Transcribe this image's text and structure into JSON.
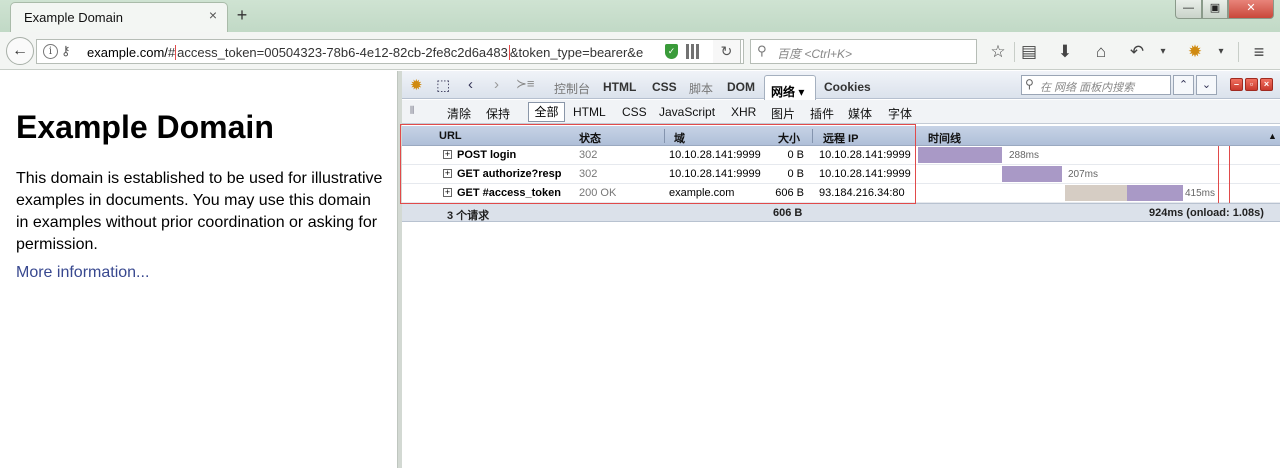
{
  "window": {
    "tab_title": "Example Domain",
    "tab_close": "×",
    "new_tab": "+",
    "min": "—",
    "max": "▣",
    "close": "✕"
  },
  "nav": {
    "back": "←",
    "url_host": "example.com/",
    "url_hash": "#",
    "url_token": "access_token=00504323-78b6-4e12-82cb-2fe8c2d6a483",
    "url_rest": "&token_type=bearer&e",
    "reload": "↻",
    "search_placeholder": "百度 <Ctrl+K>",
    "icons": [
      "star-icon",
      "reading-list-icon",
      "download-icon",
      "home-icon",
      "undo-icon",
      "firebug-icon",
      "menu-icon"
    ]
  },
  "page": {
    "title": "Example Domain",
    "body": "This domain is established to be used for illustrative examples in documents. You may use this domain in examples without prior coordination or asking for permission.",
    "link": "More information..."
  },
  "firebug": {
    "tabs": {
      "console": "控制台",
      "html": "HTML",
      "css": "CSS",
      "script": "脚本",
      "dom": "DOM",
      "net": "网络 ▾",
      "cookies": "Cookies"
    },
    "search_placeholder": "在 网络 面板内搜索",
    "filters": {
      "clear": "清除",
      "persist": "保持",
      "all": "全部",
      "html": "HTML",
      "css": "CSS",
      "js": "JavaScript",
      "xhr": "XHR",
      "images": "图片",
      "plugins": "插件",
      "media": "媒体",
      "fonts": "字体"
    },
    "columns": {
      "url": "URL",
      "status": "状态",
      "domain": "域",
      "size": "大小",
      "remote_ip": "远程 IP",
      "timeline": "时间线",
      "sort": "▲"
    },
    "requests": [
      {
        "url": "POST login",
        "status": "302",
        "domain": "10.10.28.141:9999",
        "size": "0 B",
        "ip": "10.10.28.141:9999",
        "time": "288ms"
      },
      {
        "url": "GET authorize?resp",
        "status": "302",
        "domain": "10.10.28.141:9999",
        "size": "0 B",
        "ip": "10.10.28.141:9999",
        "time": "207ms"
      },
      {
        "url": "GET #access_token",
        "status": "200 OK",
        "domain": "example.com",
        "size": "606 B",
        "ip": "93.184.216.34:80",
        "time": "415ms"
      }
    ],
    "summary": {
      "count": "3 个请求",
      "size": "606 B",
      "timing": "924ms (onload: 1.08s)"
    },
    "colors": {
      "bar_receive": "#a999c6",
      "bar_wait": "#d6cdc4",
      "highlight": "#e14a4a"
    }
  }
}
